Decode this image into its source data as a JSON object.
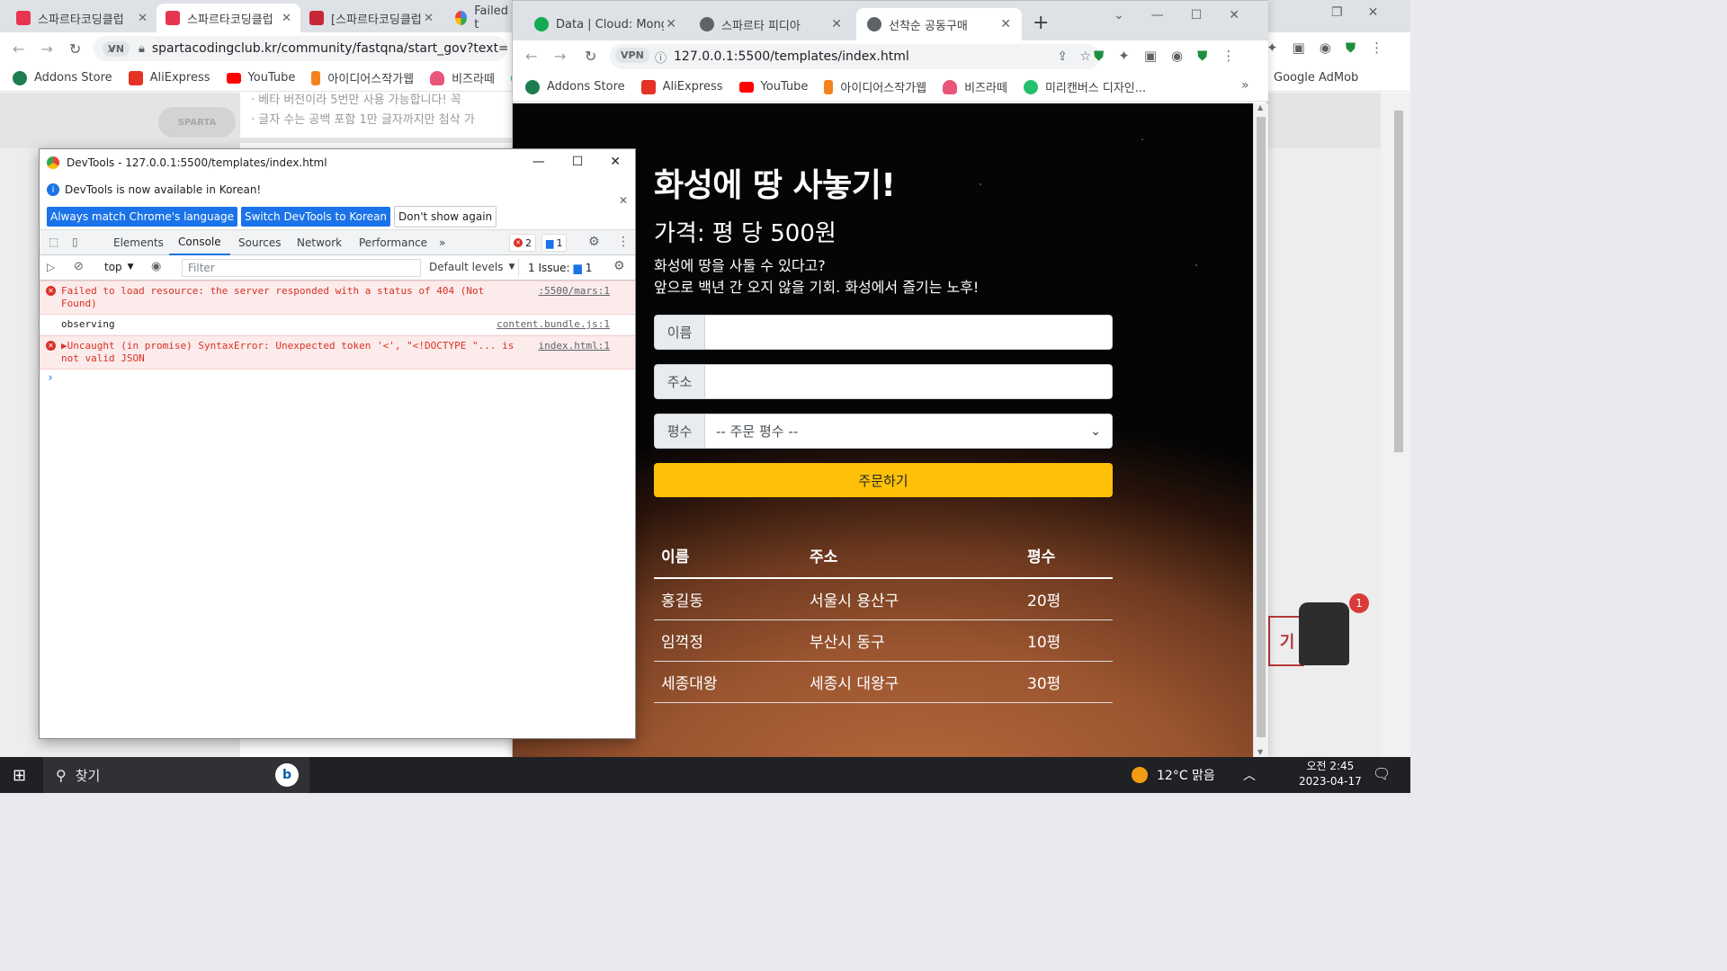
{
  "bg_browser": {
    "tabs": [
      {
        "label": "스파르타코딩클럽"
      },
      {
        "label": "스파르타코딩클럽"
      },
      {
        "label": "[스파르타코딩클럽"
      },
      {
        "label": "Failed t"
      }
    ],
    "url": "spartacodingclub.kr/community/fastqna/start_gov?text=Fai",
    "bookmarks": [
      "Addons Store",
      "AliExpress",
      "YouTube",
      "아이디어스작가웹",
      "비즈라떼",
      "Google AdMob"
    ],
    "page_lines": [
      "· 베타 버전이라 5번만 사용 가능합니다! 꼭",
      "· 글자 수는 공백 포함 1만 글자까지만 첨삭 가"
    ],
    "side_label": "기",
    "notif_count": "1",
    "logo_text": "SPARTA coding club"
  },
  "fg_browser": {
    "tabs": [
      {
        "label": "Data | Cloud: Mongo"
      },
      {
        "label": "스파르타 피디아"
      },
      {
        "label": "선착순 공동구매"
      }
    ],
    "url": "127.0.0.1:5500/templates/index.html",
    "vpn_label": "VPN",
    "bookmarks": [
      "Addons Store",
      "AliExpress",
      "YouTube",
      "아이디어스작가웹",
      "비즈라떼",
      "미리캔버스 디자인..."
    ],
    "more": "»"
  },
  "mars": {
    "title": "화성에 땅 사놓기!",
    "price": "가격: 평 당 500원",
    "desc1": "화성에 땅을 사둘 수 있다고?",
    "desc2": "앞으로 백년 간 오지 않을 기회. 화성에서 즐기는 노후!",
    "name_label": "이름",
    "address_label": "주소",
    "size_label": "평수",
    "size_placeholder": "-- 주문 평수 --",
    "order_button": "주문하기",
    "table_headers": [
      "이름",
      "주소",
      "평수"
    ],
    "rows": [
      [
        "홍길동",
        "서울시 용산구",
        "20평"
      ],
      [
        "임꺽정",
        "부산시 동구",
        "10평"
      ],
      [
        "세종대왕",
        "세종시 대왕구",
        "30평"
      ]
    ]
  },
  "devtools": {
    "title": "DevTools - 127.0.0.1:5500/templates/index.html",
    "info_text": "DevTools is now available in Korean!",
    "btn_match": "Always match Chrome's language",
    "btn_switch": "Switch DevTools to Korean",
    "btn_dont": "Don't show again",
    "tabs": [
      "Elements",
      "Console",
      "Sources",
      "Network",
      "Performance"
    ],
    "more_tabs": "»",
    "error_count": "2",
    "msg_count": "1",
    "context": "top",
    "filter_placeholder": "Filter",
    "levels": "Default levels",
    "issues": "1 Issue:",
    "issue_count": "1",
    "messages": [
      {
        "type": "error",
        "text": "Failed to load resource: the server responded with a status of 404 (Not Found)",
        "source": ":5500/mars:1"
      },
      {
        "type": "log",
        "text": "observing",
        "source": "content.bundle.js:1"
      },
      {
        "type": "error",
        "text": "▶Uncaught (in promise) SyntaxError: Unexpected token '<', \"<!DOCTYPE \"... is not valid JSON",
        "source": "index.html:1"
      }
    ],
    "prompt": "›"
  },
  "taskbar": {
    "search_label": "찾기",
    "weather": "12°C  맑음",
    "time": "오전 2:45",
    "date": "2023-04-17"
  },
  "colors": {
    "accent_blue": "#1a73e8",
    "order_yellow": "#ffc107",
    "error_red": "#d93025",
    "taskbar": "#202124"
  }
}
